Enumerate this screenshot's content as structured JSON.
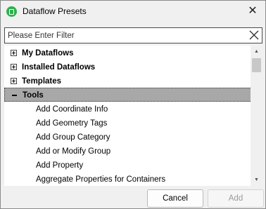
{
  "window": {
    "title": "Dataflow Presets",
    "close_glyph": "✕",
    "icon": "dataflow-app-icon",
    "accent_color": "#2bb24c"
  },
  "filter": {
    "value": "",
    "placeholder": "Please Enter Filter",
    "clear_icon": "close-icon"
  },
  "tree": {
    "groups": [
      {
        "label": "My Dataflows",
        "expanded": false
      },
      {
        "label": "Installed Dataflows",
        "expanded": false
      },
      {
        "label": "Templates",
        "expanded": false
      },
      {
        "label": "Tools",
        "expanded": true,
        "selected": true
      }
    ],
    "tool_items": [
      "Add Coordinate Info",
      "Add Geometry Tags",
      "Add Group Category",
      "Add or Modify Group",
      "Add Property",
      "Aggregate Properties for Containers"
    ],
    "selection_color": "#a8a8a8"
  },
  "scrollbar": {
    "up_glyph": "▲",
    "down_glyph": "▼"
  },
  "buttons": {
    "cancel_label": "Cancel",
    "add_label": "Add",
    "add_enabled": false
  }
}
